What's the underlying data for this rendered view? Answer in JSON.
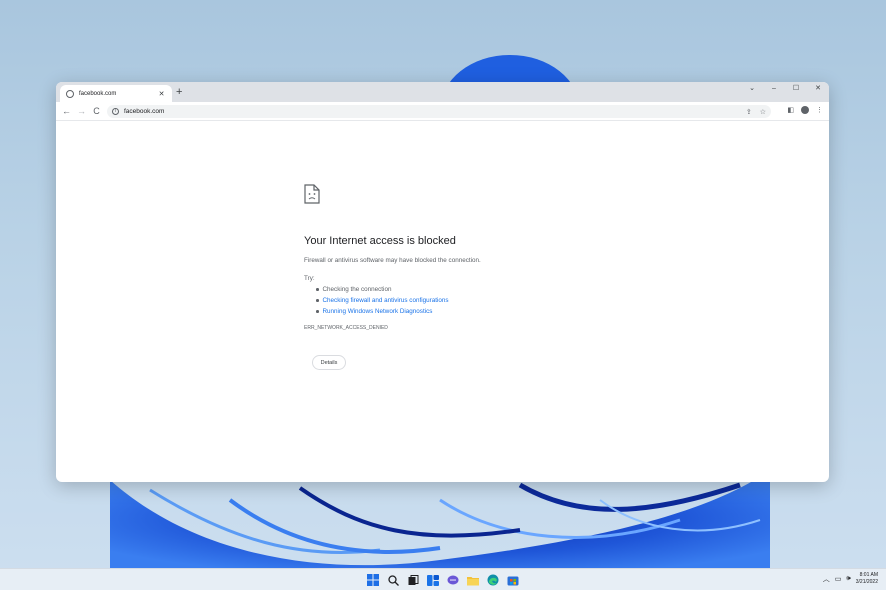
{
  "browser": {
    "tab_title": "facebook.com",
    "tab_close": "✕",
    "new_tab": "+",
    "url": "facebook.com",
    "window_controls": {
      "dropdown": "⌄",
      "minimize": "–",
      "maximize": "☐",
      "close": "✕"
    },
    "nav": {
      "back": "←",
      "forward": "→",
      "reload": "C"
    }
  },
  "error_page": {
    "title": "Your Internet access is blocked",
    "subtitle": "Firewall or antivirus software may have blocked the connection.",
    "try_label": "Try:",
    "suggestions": [
      {
        "text": "Checking the connection",
        "is_link": false
      },
      {
        "text": "Checking firewall and antivirus configurations",
        "is_link": true
      },
      {
        "text": "Running Windows Network Diagnostics",
        "is_link": true
      }
    ],
    "error_code": "ERR_NETWORK_ACCESS_DENIED",
    "details_button": "Details"
  },
  "taskbar": {
    "time": "8:01 AM",
    "date": "3/21/2022",
    "apps": [
      "start-icon",
      "search-icon",
      "task-view-icon",
      "widgets-icon",
      "chat-icon",
      "file-explorer-icon",
      "edge-icon",
      "store-icon"
    ]
  },
  "colors": {
    "link": "#1a73e8",
    "text_secondary": "#5f6368",
    "wallpaper_blue": "#1f56d8"
  }
}
